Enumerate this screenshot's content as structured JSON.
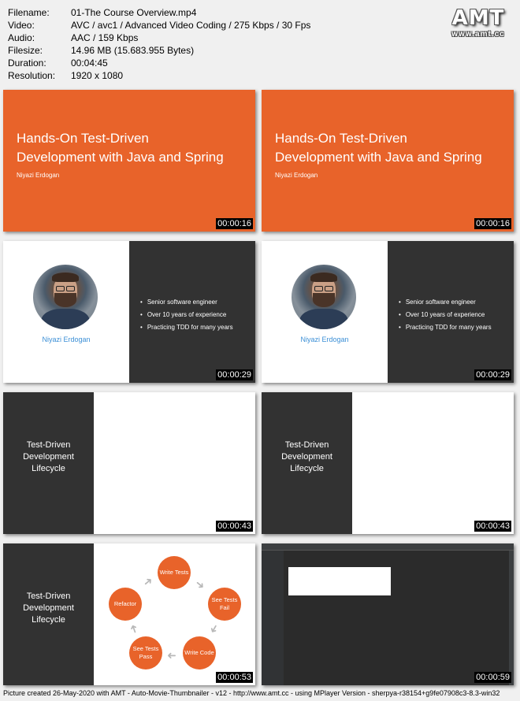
{
  "meta": {
    "rows": [
      {
        "key": "Filename:",
        "value": "01-The Course Overview.mp4"
      },
      {
        "key": "Video:",
        "value": "AVC / avc1 / Advanced Video Coding / 275 Kbps / 30 Fps"
      },
      {
        "key": "Audio:",
        "value": "AAC / 159 Kbps"
      },
      {
        "key": "Filesize:",
        "value": "14.96 MB (15.683.955 Bytes)"
      },
      {
        "key": "Duration:",
        "value": "00:04:45"
      },
      {
        "key": "Resolution:",
        "value": "1920 x 1080"
      }
    ]
  },
  "logo": {
    "big": "AMT",
    "small": "www.amt.cc"
  },
  "title_slide": {
    "title_line1": "Hands-On Test-Driven",
    "title_line2": "Development with Java and Spring",
    "author": "Niyazi Erdogan"
  },
  "bio_slide": {
    "name": "Niyazi Erdogan",
    "bullets": [
      "Senior software engineer",
      "Over 10 years of experience",
      "Practicing TDD for many years"
    ]
  },
  "lifecycle": {
    "line1": "Test-Driven",
    "line2": "Development",
    "line3": "Lifecycle"
  },
  "cycle_nodes": {
    "write_tests": "Write Tests",
    "see_fail": "See Tests Fail",
    "write_code": "Write Code",
    "see_pass": "See Tests Pass",
    "refactor": "Refactor"
  },
  "timestamps": [
    "00:00:16",
    "00:00:16",
    "00:00:29",
    "00:00:29",
    "00:00:43",
    "00:00:43",
    "00:00:53",
    "00:00:59"
  ],
  "footer": "Picture created 26-May-2020 with AMT - Auto-Movie-Thumbnailer - v12 - http://www.amt.cc - using MPlayer Version - sherpya-r38154+g9fe07908c3-8.3-win32"
}
